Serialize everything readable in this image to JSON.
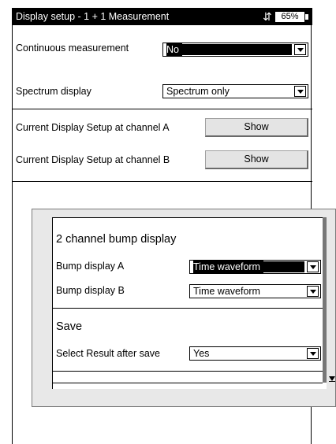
{
  "titlebar": {
    "title": "Display setup - 1 + 1 Measurement",
    "bluetooth_icon": "bluetooth-icon",
    "battery": "65%"
  },
  "settings": {
    "continuous_label": "Continuous measurement",
    "continuous_value": "No",
    "spectrum_label": "Spectrum display",
    "spectrum_value": "Spectrum only",
    "channel_a_label": "Current Display Setup at channel A",
    "channel_a_button": "Show",
    "channel_b_label": "Current Display Setup at channel B",
    "channel_b_button": "Show"
  },
  "panel": {
    "bump_section": "2 channel bump display",
    "bump_a_label": "Bump display A",
    "bump_a_value": "Time waveform",
    "bump_b_label": "Bump display B",
    "bump_b_value": "Time waveform",
    "save_section": "Save",
    "select_result_label": "Select Result after save",
    "select_result_value": "Yes"
  }
}
